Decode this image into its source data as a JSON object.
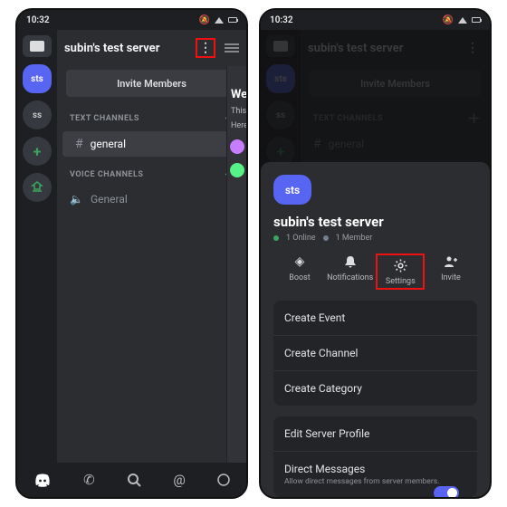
{
  "statusbar": {
    "time": "10:32",
    "badge": "⧉"
  },
  "left": {
    "server_title": "subin's test server",
    "invite_label": "Invite Members",
    "text_header": "TEXT CHANNELS",
    "text_channel": "general",
    "voice_header": "VOICE CHANNELS",
    "voice_channel": "General",
    "peek_title": "We",
    "peek_line1": "This",
    "peek_line2": "Here",
    "guild_sts": "sts",
    "guild_ss": "ss"
  },
  "sheet": {
    "icon_label": "sts",
    "server_name": "subin's test server",
    "online": "1 Online",
    "members": "1 Member",
    "actions": {
      "boost": "Boost",
      "notifications": "Notifications",
      "settings": "Settings",
      "invite": "Invite"
    },
    "menu": {
      "create_event": "Create Event",
      "create_channel": "Create Channel",
      "create_category": "Create Category",
      "edit_profile": "Edit Server Profile",
      "dm_title": "Direct Messages",
      "dm_sub": "Allow direct messages from server members."
    }
  }
}
